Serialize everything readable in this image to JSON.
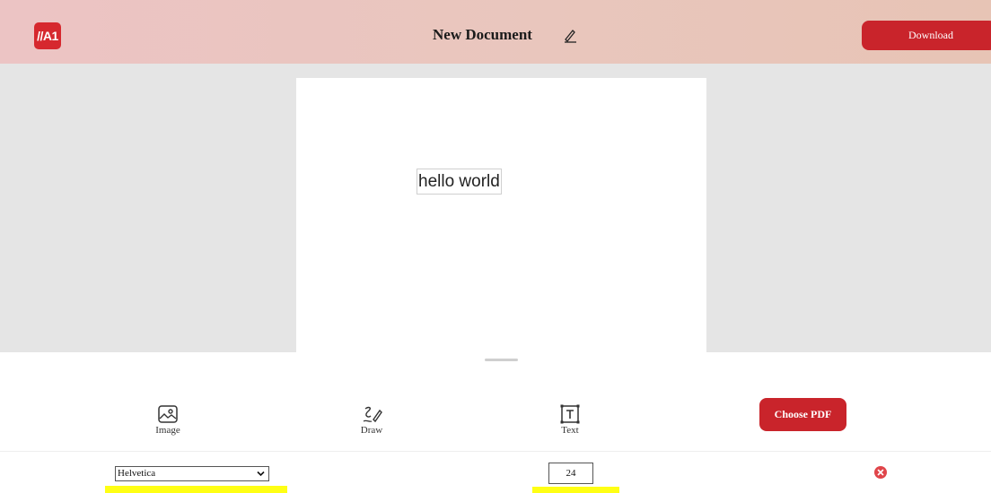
{
  "header": {
    "logo_text": "//A1",
    "document_title": "New Document",
    "edit_icon": "pencil-icon",
    "download_label": "Download",
    "brand_color": "#c9242b"
  },
  "canvas": {
    "text_element": "hello world"
  },
  "toolbar": {
    "tools": [
      {
        "label": "Image",
        "icon": "image-icon"
      },
      {
        "label": "Draw",
        "icon": "draw-icon"
      },
      {
        "label": "Text",
        "icon": "text-box-icon"
      }
    ],
    "choose_pdf_label": "Choose PDF"
  },
  "text_settings": {
    "font_family": "Helvetica",
    "font_size": "24",
    "delete_icon": "close-circle-icon",
    "highlight_color": "#ffff14"
  }
}
